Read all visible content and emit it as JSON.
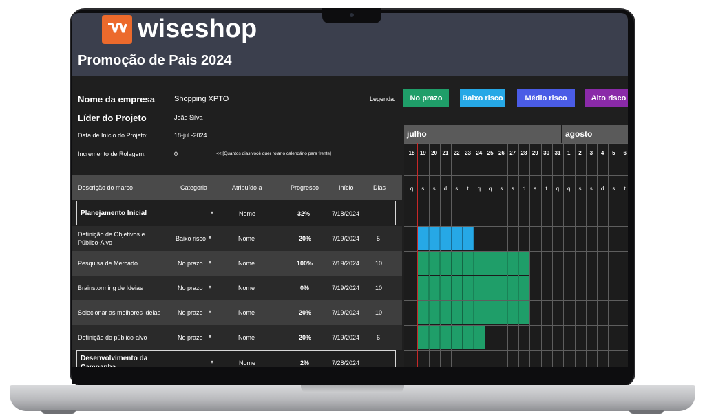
{
  "brand": {
    "name": "wiseshop",
    "logo_glyph": "W",
    "accent": "#ec6a2c"
  },
  "project": {
    "title": "Promoção de Pais 2024",
    "company_label": "Nome da empresa",
    "company_value": "Shopping XPTO",
    "leader_label": "Líder do Projeto",
    "leader_value": "João Silva",
    "start_label": "Data de Início do Projeto:",
    "start_value": "18-jul.-2024",
    "roll_label": "Incremento de Rolagem:",
    "roll_value": "0",
    "roll_hint": "<< [Quantos dias você quer rolar o calendário para frente]"
  },
  "legend": {
    "title": "Legenda:",
    "items": [
      {
        "label": "No prazo",
        "color": "#1f9e69"
      },
      {
        "label": "Baixo risco",
        "color": "#26a8e6"
      },
      {
        "label": "Médio risco",
        "color": "#4a5ce6"
      },
      {
        "label": "Alto risco",
        "color": "#8a2aa8"
      }
    ]
  },
  "columns": [
    "Descrição do marco",
    "Categoria",
    "Atribuído a",
    "Progresso",
    "Início",
    "Dias"
  ],
  "rows": [
    {
      "desc": "Planejamento Inicial",
      "cat": "",
      "who": "Nome",
      "prog": "32%",
      "start": "7/18/2024",
      "days": "",
      "phase": true
    },
    {
      "desc": "Definição de Objetivos e Público-Alvo",
      "cat": "Baixo risco",
      "who": "Nome",
      "prog": "20%",
      "start": "7/19/2024",
      "days": "5",
      "phase": false
    },
    {
      "desc": "Pesquisa de Mercado",
      "cat": "No prazo",
      "who": "Nome",
      "prog": "100%",
      "start": "7/19/2024",
      "days": "10",
      "phase": false
    },
    {
      "desc": "Brainstorming de Ideias",
      "cat": "No prazo",
      "who": "Nome",
      "prog": "0%",
      "start": "7/19/2024",
      "days": "10",
      "phase": false
    },
    {
      "desc": "Selecionar as melhores ideias",
      "cat": "No prazo",
      "who": "Nome",
      "prog": "20%",
      "start": "7/19/2024",
      "days": "10",
      "phase": false
    },
    {
      "desc": "Definição do público-alvo",
      "cat": "No prazo",
      "who": "Nome",
      "prog": "20%",
      "start": "7/19/2024",
      "days": "6",
      "phase": false
    },
    {
      "desc": "Desenvolvimento da Campanha",
      "cat": "",
      "who": "Nome",
      "prog": "2%",
      "start": "7/28/2024",
      "days": "",
      "phase": true
    }
  ],
  "gantt": {
    "months": [
      {
        "label": "julho"
      },
      {
        "label": "agosto"
      }
    ],
    "days": [
      "18",
      "19",
      "20",
      "21",
      "22",
      "23",
      "24",
      "25",
      "26",
      "27",
      "28",
      "29",
      "30",
      "31",
      "1",
      "2",
      "3",
      "4",
      "5",
      "6"
    ],
    "weekdays": [
      "q",
      "s",
      "s",
      "d",
      "s",
      "t",
      "q",
      "q",
      "s",
      "s",
      "d",
      "s",
      "t",
      "q",
      "q",
      "s",
      "s",
      "d",
      "s",
      "t"
    ],
    "bars": [
      {
        "row": 1,
        "start_day": "19",
        "days": 5,
        "color": "#26a8e6"
      },
      {
        "row": 2,
        "start_day": "19",
        "days": 10,
        "color": "#1f9e69"
      },
      {
        "row": 3,
        "start_day": "19",
        "days": 10,
        "color": "#1f9e69"
      },
      {
        "row": 4,
        "start_day": "19",
        "days": 10,
        "color": "#1f9e69"
      },
      {
        "row": 5,
        "start_day": "19",
        "days": 6,
        "color": "#1f9e69"
      }
    ]
  }
}
